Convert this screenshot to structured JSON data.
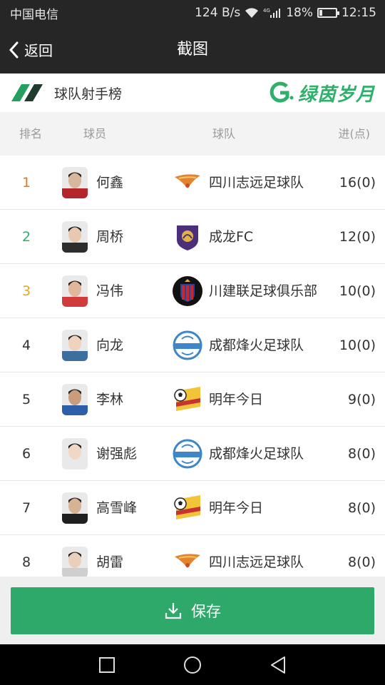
{
  "status_bar": {
    "carrier": "中国电信",
    "net_speed": "124 B/s",
    "network": "4G",
    "battery_text": "18%",
    "battery_level": 0.18,
    "time": "12:15"
  },
  "title_bar": {
    "back_label": "返回",
    "title": "截图"
  },
  "board": {
    "title": "球队射手榜",
    "brand": "绿茵岁月"
  },
  "columns": {
    "rank": "排名",
    "player": "球员",
    "team": "球队",
    "goals": "进(点)"
  },
  "colors": {
    "accent": "#2ea96a",
    "rank1": "#e07b1d",
    "rank2": "#2eb06b",
    "rank3": "#e8a71a",
    "rank_default": "#333333"
  },
  "rows": [
    {
      "rank": "1",
      "player": "何鑫",
      "team": "四川志远足球队",
      "goals": "16(0)",
      "team_icon": "wing-emblem-icon"
    },
    {
      "rank": "2",
      "player": "周桥",
      "team": "成龙FC",
      "goals": "12(0)",
      "team_icon": "dragon-shield-icon"
    },
    {
      "rank": "3",
      "player": "冯伟",
      "team": "川建联足球俱乐部",
      "goals": "10(0)",
      "team_icon": "round-crest-icon"
    },
    {
      "rank": "4",
      "player": "向龙",
      "team": "成都烽火足球队",
      "goals": "10(0)",
      "team_icon": "blue-ring-icon"
    },
    {
      "rank": "5",
      "player": "李林",
      "team": "明年今日",
      "goals": "9(0)",
      "team_icon": "ball-banner-icon"
    },
    {
      "rank": "6",
      "player": "谢强彪",
      "team": "成都烽火足球队",
      "goals": "8(0)",
      "team_icon": "blue-ring-icon"
    },
    {
      "rank": "7",
      "player": "高雪峰",
      "team": "明年今日",
      "goals": "8(0)",
      "team_icon": "ball-banner-icon"
    },
    {
      "rank": "8",
      "player": "胡雷",
      "team": "四川志远足球队",
      "goals": "8(0)",
      "team_icon": "wing-emblem-icon"
    }
  ],
  "save_button": {
    "label": "保存"
  },
  "nav": {
    "recent": "recent-apps-icon",
    "home": "home-circle-icon",
    "back": "back-triangle-icon"
  }
}
